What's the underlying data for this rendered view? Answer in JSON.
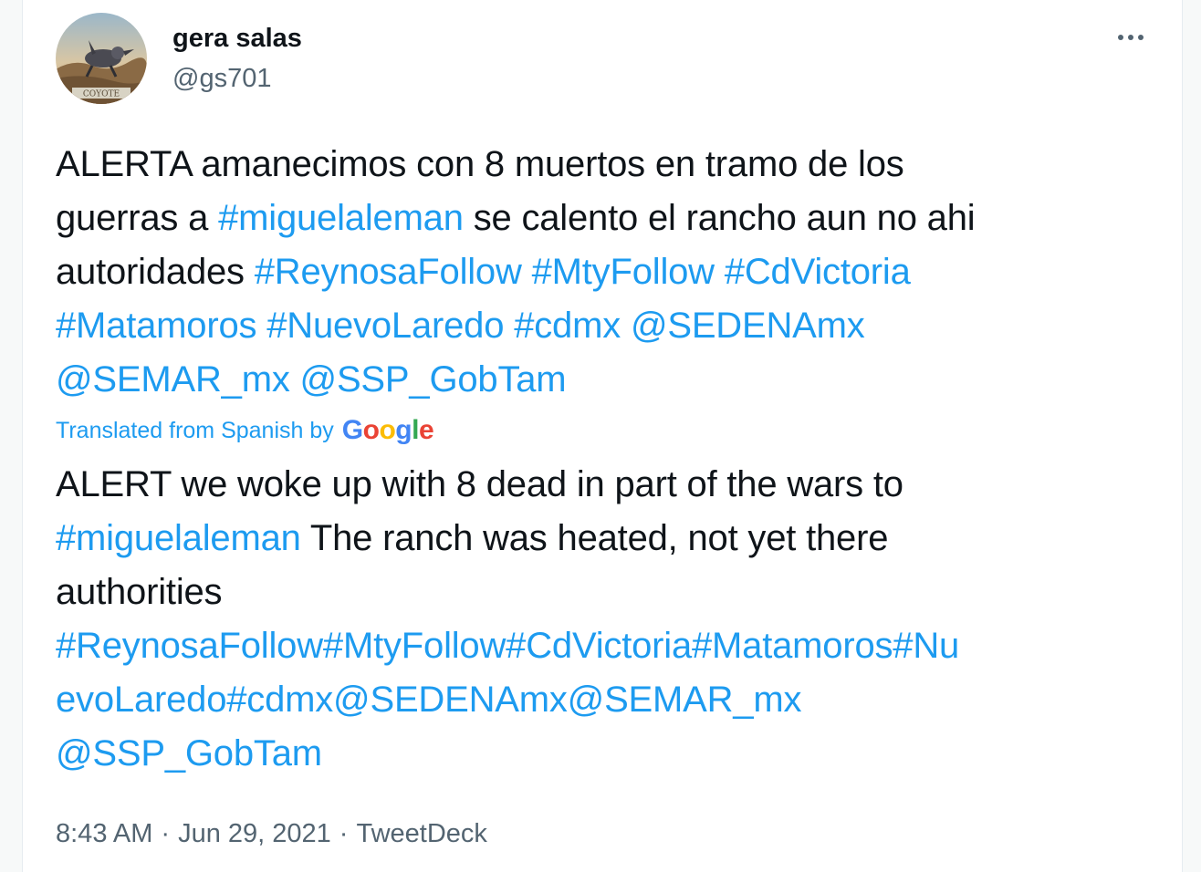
{
  "author": {
    "display_name": "gera salas",
    "handle": "@gs701",
    "avatar_caption": "COYOTE"
  },
  "more_icon": "more-horizontal-icon",
  "tweet": {
    "lines": [
      [
        {
          "t": "ALERTA amanecimos con 8 muertos en tramo de los",
          "link": false
        }
      ],
      [
        {
          "t": "guerras a ",
          "link": false
        },
        {
          "t": "#miguelaleman",
          "link": true
        },
        {
          "t": " se calento el rancho aun no ahi",
          "link": false
        }
      ],
      [
        {
          "t": "autoridades ",
          "link": false
        },
        {
          "t": "#ReynosaFollow",
          "link": true
        },
        {
          "t": " ",
          "link": false
        },
        {
          "t": "#MtyFollow",
          "link": true
        },
        {
          "t": " ",
          "link": false
        },
        {
          "t": "#CdVictoria",
          "link": true
        }
      ],
      [
        {
          "t": "#Matamoros",
          "link": true
        },
        {
          "t": " ",
          "link": false
        },
        {
          "t": "#NuevoLaredo",
          "link": true
        },
        {
          "t": " ",
          "link": false
        },
        {
          "t": "#cdmx",
          "link": true
        },
        {
          "t": " ",
          "link": false
        },
        {
          "t": "@SEDENAmx",
          "link": true
        }
      ],
      [
        {
          "t": "@SEMAR_mx",
          "link": true
        },
        {
          "t": " ",
          "link": false
        },
        {
          "t": "@SSP_GobTam",
          "link": true
        }
      ]
    ]
  },
  "translation": {
    "label": "Translated from Spanish by",
    "provider_letters": [
      {
        "ch": "G",
        "color": "#4285F4"
      },
      {
        "ch": "o",
        "color": "#EA4335"
      },
      {
        "ch": "o",
        "color": "#FBBC05"
      },
      {
        "ch": "g",
        "color": "#4285F4"
      },
      {
        "ch": "l",
        "color": "#34A853"
      },
      {
        "ch": "e",
        "color": "#EA4335"
      }
    ],
    "lines": [
      [
        {
          "t": "ALERT we woke up with 8 dead in part of the wars to",
          "link": false
        }
      ],
      [
        {
          "t": "#miguelaleman",
          "link": true
        },
        {
          "t": " The ranch was heated, not yet there",
          "link": false
        }
      ],
      [
        {
          "t": "authorities",
          "link": false
        }
      ],
      [
        {
          "t": "#ReynosaFollow#MtyFollow#CdVictoria#Matamoros#Nu",
          "link": true
        }
      ],
      [
        {
          "t": "evoLaredo#cdmx@SEDENAmx@SEMAR_mx",
          "link": true
        }
      ],
      [
        {
          "t": "@SSP_GobTam",
          "link": true
        }
      ]
    ]
  },
  "footer": {
    "time": "8:43 AM",
    "separator": "·",
    "date": "Jun 29, 2021",
    "source": "TweetDeck"
  },
  "colors": {
    "link": "#1d9bf0",
    "text": "#0f1419",
    "muted": "#536471"
  }
}
